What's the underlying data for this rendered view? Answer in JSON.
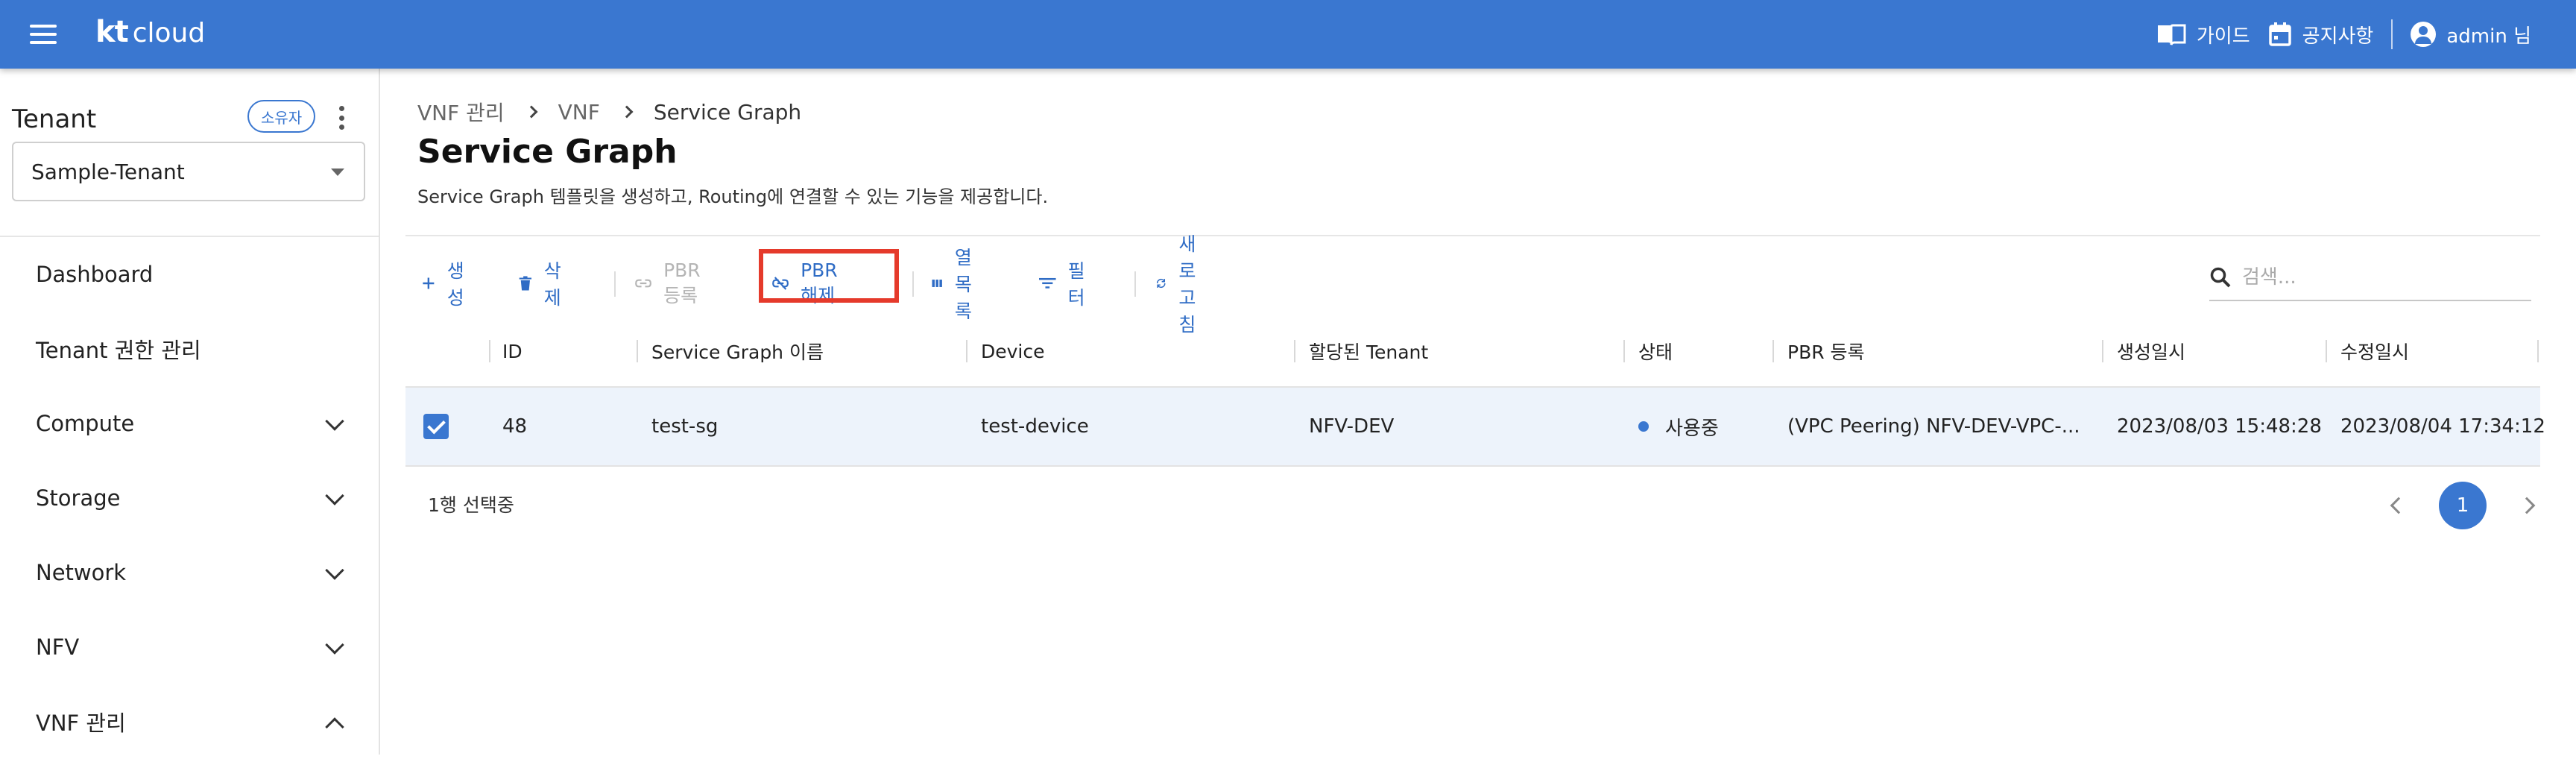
{
  "header": {
    "logo_kt": "kt",
    "logo_cloud": "cloud",
    "guide_label": "가이드",
    "notice_label": "공지사항",
    "user_label": "admin 님"
  },
  "sidebar": {
    "tenant_title": "Tenant",
    "owner_chip": "소유자",
    "tenant_selected": "Sample-Tenant",
    "items": [
      {
        "label": "Dashboard"
      },
      {
        "label": "Tenant 권한 관리"
      },
      {
        "label": "Compute"
      },
      {
        "label": "Storage"
      },
      {
        "label": "Network"
      },
      {
        "label": "NFV"
      },
      {
        "label": "VNF 관리"
      }
    ]
  },
  "breadcrumb": [
    "VNF 관리",
    "VNF",
    "Service Graph"
  ],
  "page": {
    "title": "Service Graph",
    "description": "Service Graph 템플릿을 생성하고, Routing에 연결할 수 있는 기능을 제공합니다."
  },
  "toolbar": {
    "create": "생성",
    "delete": "삭제",
    "pbr_register": "PBR 등록",
    "pbr_release": "PBR 해제",
    "columns": "열 목록",
    "filter": "필터",
    "refresh": "새로고침",
    "search_placeholder": "검색..."
  },
  "table": {
    "columns": [
      "ID",
      "Service Graph 이름",
      "Device",
      "할당된 Tenant",
      "상태",
      "PBR 등록",
      "생성일시",
      "수정일시"
    ],
    "rows": [
      {
        "id": "48",
        "name": "test-sg",
        "device": "test-device",
        "tenant": "NFV-DEV",
        "status": "사용중",
        "pbr": "(VPC Peering) NFV-DEV-VPC-...",
        "created": "2023/08/03 15:48:28",
        "modified": "2023/08/04 17:34:12"
      }
    ],
    "selection_text": "1행 선택중",
    "page": "1"
  },
  "colors": {
    "primary": "#3a77d0",
    "highlight": "#e53a2b",
    "selected_row": "#edf3fb"
  }
}
